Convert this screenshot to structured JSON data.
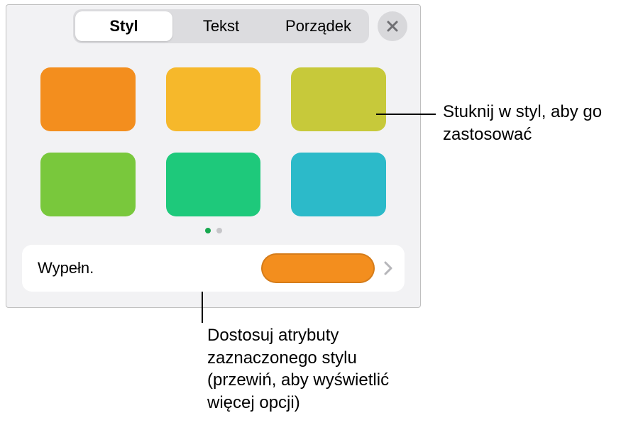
{
  "tabs": {
    "style": "Styl",
    "text": "Tekst",
    "order": "Porządek"
  },
  "swatches": [
    {
      "color": "#f38e1e"
    },
    {
      "color": "#f6b82b"
    },
    {
      "color": "#c7c93a"
    },
    {
      "color": "#79c83c"
    },
    {
      "color": "#1ec97b"
    },
    {
      "color": "#2cbac9"
    }
  ],
  "fill": {
    "label": "Wypełn.",
    "previewColor": "#f38e1e"
  },
  "callouts": {
    "swatch": "Stuknij w styl, aby go zastosować",
    "fill": "Dostosuj atrybuty zaznaczonego stylu (przewiń, aby wyświetlić więcej opcji)"
  }
}
